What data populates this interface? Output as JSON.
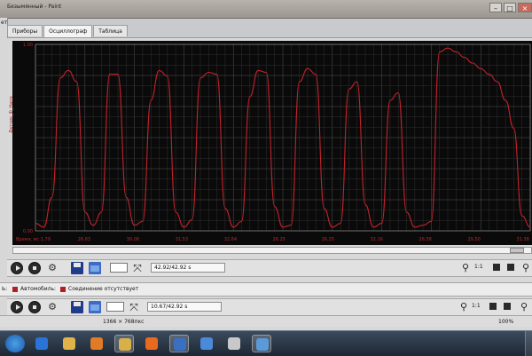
{
  "window": {
    "title": "Безымянный - Paint"
  },
  "left_strip": {
    "label": "ет"
  },
  "tabs": [
    {
      "label": "Приборы",
      "active": false
    },
    {
      "label": "Осциллограф",
      "active": true
    },
    {
      "label": "Таблица",
      "active": false
    }
  ],
  "chart_data": {
    "type": "line",
    "title": "",
    "xlabel": "Время, мс",
    "ylabel": "Датчик_Ф_Напр",
    "x_ticks": [
      "Время, мс 1.79",
      "26.63",
      "30.06",
      "31.53",
      "32.84",
      "26.25",
      "26.25",
      "32.16",
      "26.58",
      "29.50",
      "31.38"
    ],
    "y_ticks": [
      "1.00",
      "0.00"
    ],
    "ylim": [
      0,
      1
    ],
    "grid": true,
    "series": [
      {
        "color": "#c0232b",
        "x": [
          0,
          1,
          2,
          3,
          4,
          5,
          6,
          7,
          8,
          9,
          10,
          11,
          12,
          13,
          14,
          15,
          16,
          17,
          18,
          19,
          20,
          21,
          22,
          23,
          24,
          25,
          26,
          27,
          28,
          29,
          30,
          31,
          32,
          33,
          34,
          35,
          36,
          37,
          38,
          39,
          40,
          41,
          42,
          43,
          44,
          45,
          46,
          47,
          48,
          49,
          50,
          51,
          52,
          53,
          54,
          55,
          56,
          57,
          58,
          59,
          60
        ],
        "y": [
          0.04,
          0.02,
          0.18,
          0.82,
          0.86,
          0.8,
          0.1,
          0.03,
          0.1,
          0.84,
          0.84,
          0.18,
          0.03,
          0.05,
          0.7,
          0.86,
          0.83,
          0.1,
          0.02,
          0.06,
          0.82,
          0.85,
          0.84,
          0.12,
          0.02,
          0.05,
          0.72,
          0.86,
          0.85,
          0.13,
          0.02,
          0.03,
          0.8,
          0.87,
          0.84,
          0.12,
          0.02,
          0.04,
          0.76,
          0.8,
          0.14,
          0.02,
          0.04,
          0.7,
          0.74,
          0.1,
          0.02,
          0.03,
          0.05,
          0.96,
          0.98,
          0.96,
          0.93,
          0.9,
          0.87,
          0.84,
          0.8,
          0.7,
          0.55,
          0.08,
          0.02
        ]
      }
    ]
  },
  "toolbar_top": {
    "time_value": "42.92/42.92 s",
    "ratio": "1:1"
  },
  "statusbar": {
    "prefix": "Ь:",
    "items": [
      "Автомобиль:",
      "Соединение отсутствует"
    ]
  },
  "toolbar_bottom": {
    "time_value": "10.67/42.92 s",
    "ratio": "1:1"
  },
  "paint_status": {
    "dimensions": "1366 × 768пкс",
    "zoom": "100%"
  },
  "taskbar": {
    "icons": [
      {
        "name": "ie-icon",
        "color": "#2a73d8",
        "active": false
      },
      {
        "name": "folder-icon",
        "color": "#e0b24a",
        "active": false
      },
      {
        "name": "media-icon",
        "color": "#e07b26",
        "active": false
      },
      {
        "name": "explorer-icon",
        "color": "#d8b04a",
        "active": true
      },
      {
        "name": "firefox-icon",
        "color": "#e86a1f",
        "active": false
      },
      {
        "name": "scanner-icon",
        "color": "#3a6fc2",
        "active": true
      },
      {
        "name": "app-icon",
        "color": "#4a8ad8",
        "active": false
      },
      {
        "name": "disc-icon",
        "color": "#c8c8c8",
        "active": false
      },
      {
        "name": "paint-icon",
        "color": "#5a9ad8",
        "active": true
      }
    ]
  }
}
